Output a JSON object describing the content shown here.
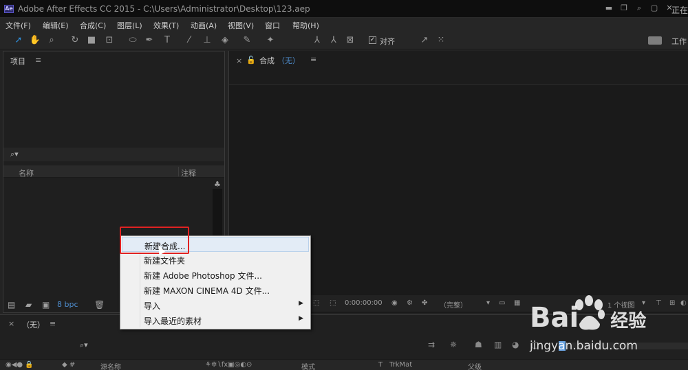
{
  "window": {
    "title": "Adobe After Effects CC 2015 - C:\\Users\\Administrator\\Desktop\\123.aep",
    "logo": "Ae",
    "right_label": "正在"
  },
  "menubar": {
    "items": [
      {
        "label": "文件(F)"
      },
      {
        "label": "编辑(E)"
      },
      {
        "label": "合成(C)"
      },
      {
        "label": "图层(L)"
      },
      {
        "label": "效果(T)"
      },
      {
        "label": "动画(A)"
      },
      {
        "label": "视图(V)"
      },
      {
        "label": "窗口"
      },
      {
        "label": "帮助(H)"
      }
    ]
  },
  "toolbar": {
    "snap_label": "对齐",
    "workspace_label": "工作"
  },
  "project_panel": {
    "title": "项目",
    "columns": {
      "name": "名称",
      "note": "注释"
    },
    "bpc": "8 bpc"
  },
  "comp_panel": {
    "title": "合成",
    "comp_name": "（无）",
    "timecode": "0:00:00:00",
    "resolution": "（完整）",
    "views": "1 个视图"
  },
  "timeline": {
    "title": "（无）",
    "columns": {
      "source_name": "源名称",
      "mode": "模式",
      "t": "T",
      "trkmat": "TrkMat",
      "parent": "父级"
    }
  },
  "context_menu": {
    "items": [
      {
        "label": "新建合成...",
        "submenu": false,
        "hover": true
      },
      {
        "label": "新建文件夹",
        "submenu": false
      },
      {
        "label": "新建 Adobe Photoshop 文件...",
        "submenu": false
      },
      {
        "label": "新建 MAXON CINEMA 4D 文件...",
        "submenu": false
      },
      {
        "label": "导入",
        "submenu": true
      },
      {
        "label": "导入最近的素材",
        "submenu": true
      }
    ],
    "highlight_color": "#e02222"
  },
  "watermark": {
    "logo_text": "Bai",
    "logo_text2": "经验",
    "url": "jingyan.baidu.com"
  }
}
